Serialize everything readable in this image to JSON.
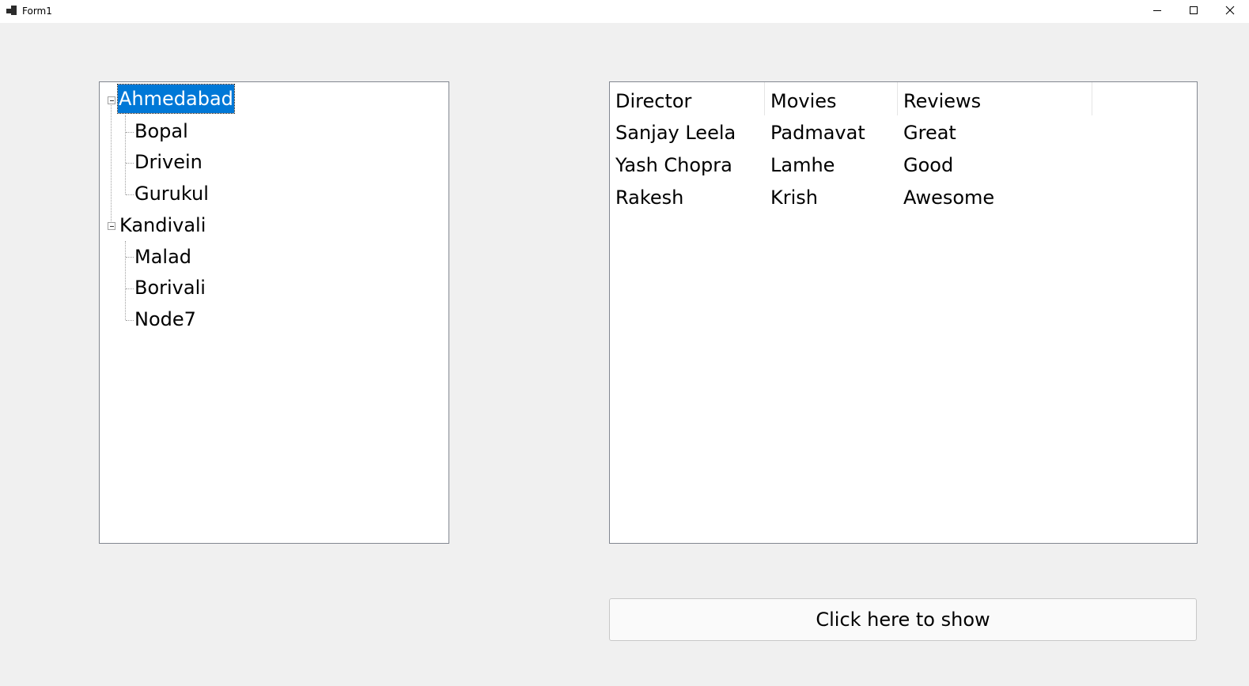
{
  "window": {
    "title": "Form1"
  },
  "tree": {
    "nodes": [
      {
        "label": "Ahmedabad",
        "children": [
          "Bopal",
          "Drivein",
          "Gurukul"
        ]
      },
      {
        "label": "Kandivali",
        "children": [
          "Malad",
          "Borivali",
          "Node7"
        ]
      }
    ]
  },
  "listview": {
    "columns": [
      "Director",
      "Movies",
      "Reviews"
    ],
    "rows": [
      [
        "Sanjay Leela",
        "Padmavat",
        "Great"
      ],
      [
        "Yash Chopra",
        "Lamhe",
        "Good"
      ],
      [
        "Rakesh",
        "Krish",
        "Awesome"
      ]
    ]
  },
  "button": {
    "label": "Click here to show"
  },
  "colors": {
    "selection": "#0078d7",
    "window_bg": "#f0f0f0"
  }
}
